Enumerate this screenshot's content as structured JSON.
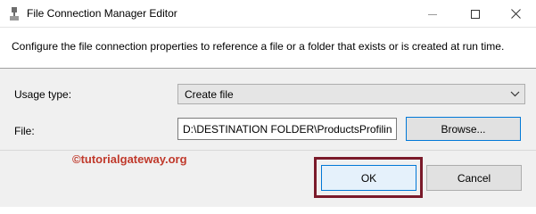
{
  "window": {
    "title": "File Connection Manager Editor",
    "controls": {
      "minimize": "minimize",
      "maximize": "maximize",
      "close": "close"
    }
  },
  "description": "Configure the file connection properties to reference a file or a folder that exists or is created at run time.",
  "form": {
    "usage_label": "Usage type:",
    "usage_value": "Create file",
    "file_label": "File:",
    "file_value": "D:\\DESTINATION FOLDER\\ProductsProfiling.xml",
    "browse_label": "Browse..."
  },
  "footer": {
    "ok_label": "OK",
    "cancel_label": "Cancel"
  },
  "watermark": "©tutorialgateway.org",
  "colors": {
    "accent": "#0078d7",
    "highlight_border": "#7a1a2a",
    "watermark": "#c0392b"
  },
  "icons": [
    "app-icon",
    "minimize-icon",
    "maximize-icon",
    "close-icon",
    "chevron-down-icon"
  ]
}
